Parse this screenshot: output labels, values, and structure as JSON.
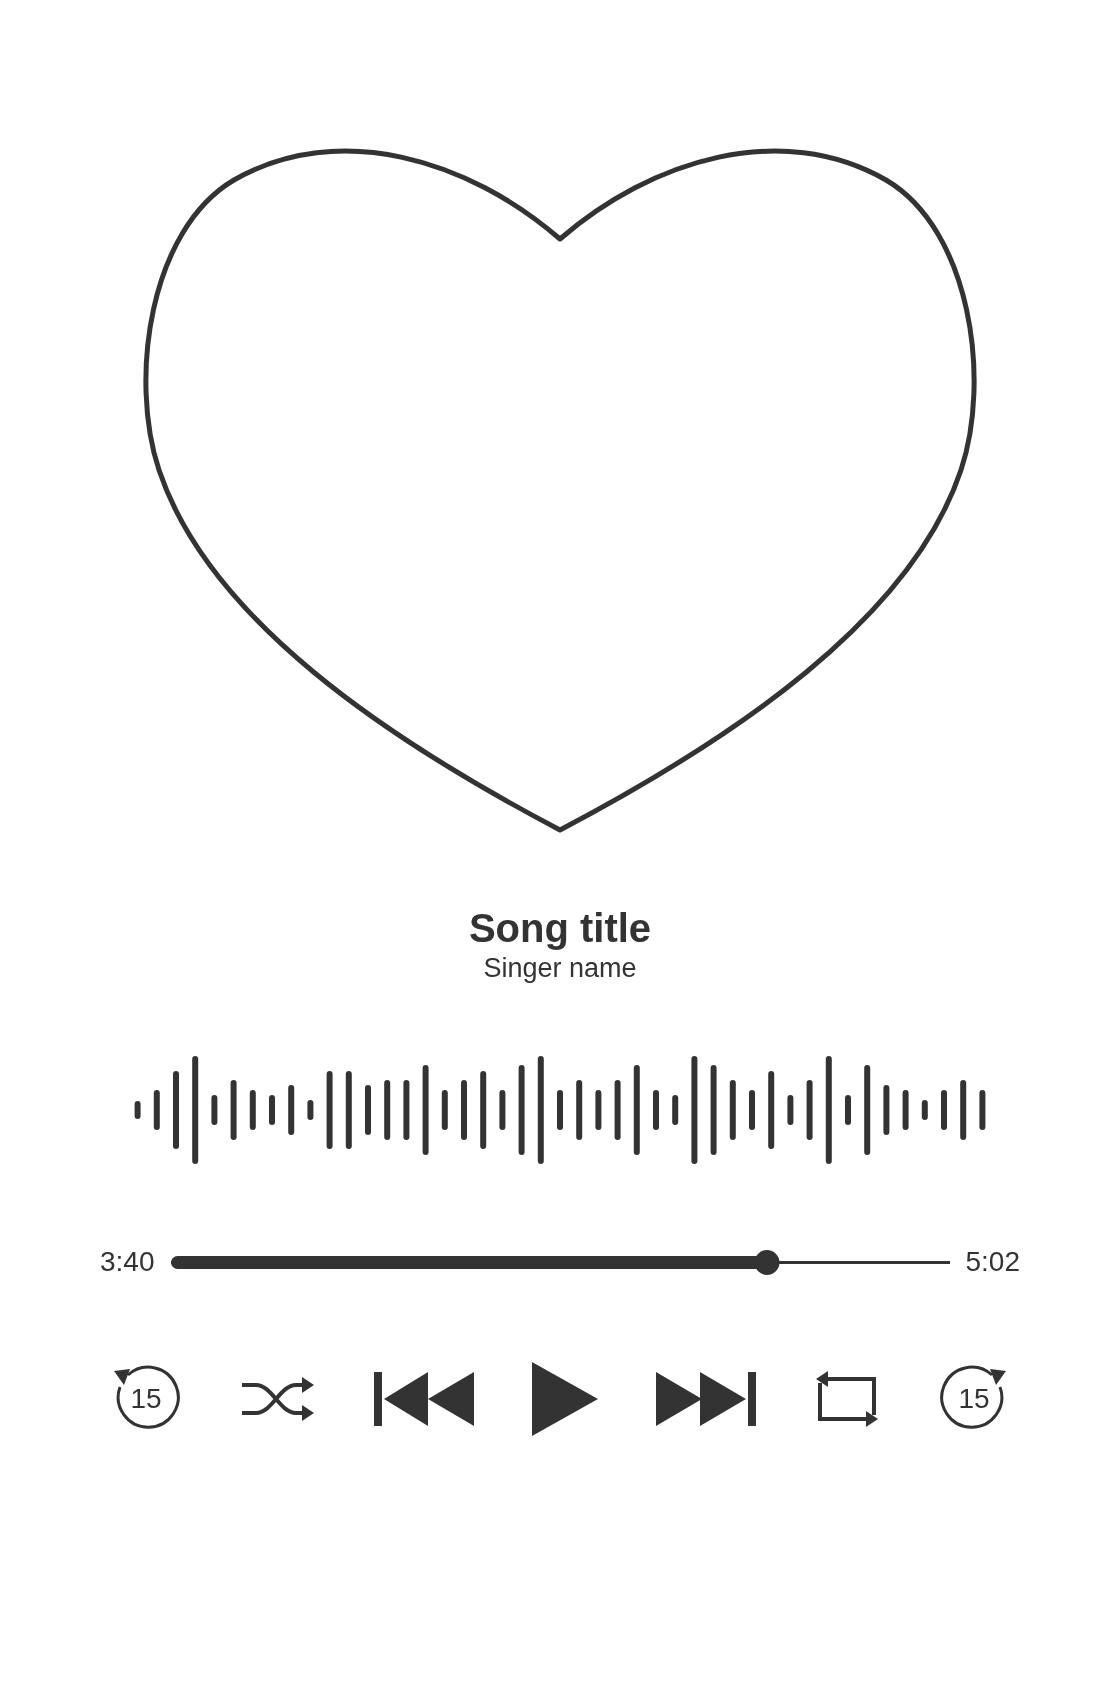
{
  "cover": {
    "kind": "heart"
  },
  "track": {
    "title": "Song title",
    "artist": "Singer name"
  },
  "progress": {
    "elapsed": "3:40",
    "duration": "5:02",
    "level": 0.766
  },
  "controls": [
    {
      "kind": "skip_back",
      "label": "15"
    },
    {
      "kind": "shuffle"
    },
    {
      "kind": "previous"
    },
    {
      "kind": "play"
    },
    {
      "kind": "next"
    },
    {
      "kind": "repeat"
    },
    {
      "kind": "skip_forward",
      "label": "15"
    }
  ]
}
